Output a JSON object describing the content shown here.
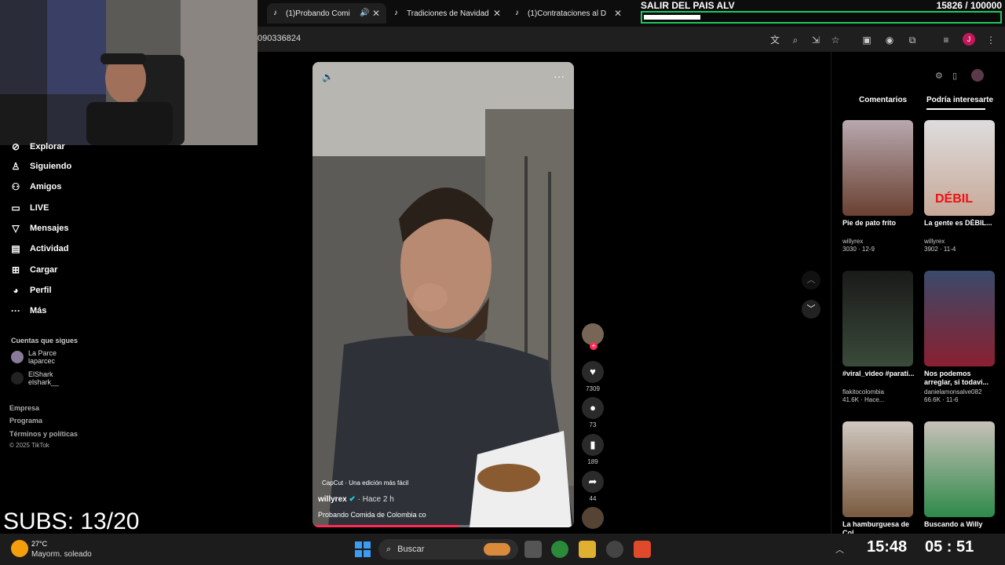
{
  "tabs": [
    {
      "title": "(1)Probando Comi"
    },
    {
      "title": "Tradiciones de Navidad"
    },
    {
      "title": "(1)Contrataciones al D"
    }
  ],
  "address": {
    "text": "090336824"
  },
  "goal": {
    "title": "SALIR DEL PAIS ALV",
    "current": "15826",
    "target": "/ 100000",
    "progress": 0.158
  },
  "sidebar": {
    "items": [
      {
        "label": "Explorar",
        "icon": "compass-icon"
      },
      {
        "label": "Siguiendo",
        "icon": "user-icon"
      },
      {
        "label": "Amigos",
        "icon": "friends-icon"
      },
      {
        "label": "LIVE",
        "icon": "live-icon"
      },
      {
        "label": "Mensajes",
        "icon": "send-icon"
      },
      {
        "label": "Actividad",
        "icon": "activity-icon"
      },
      {
        "label": "Cargar",
        "icon": "upload-icon"
      },
      {
        "label": "Perfil",
        "icon": "avatar-icon"
      },
      {
        "label": "Más",
        "icon": "more-icon"
      }
    ],
    "follow_title": "Cuentas que sigues",
    "accounts": [
      {
        "name": "La Parce",
        "handle": "laparcec"
      },
      {
        "name": "ElShark",
        "handle": "elshark__"
      }
    ],
    "footer": [
      "Empresa",
      "Programa",
      "Términos y políticas",
      "© 2025 TikTok"
    ]
  },
  "video": {
    "capcut": "CapCut · Una edición más fácil",
    "author": "willyrex",
    "time": "· Hace 2 h",
    "description": "Probando Comida de Colombia co",
    "progress": 0.56
  },
  "actions": {
    "likes": "7309",
    "comments": "73",
    "saves": "189",
    "shares": "44"
  },
  "rightpanel": {
    "tab_comments": "Comentarios",
    "tab_suggested": "Podría interesarte",
    "cards": [
      {
        "title": "Pie de pato frito",
        "user": "willyrex",
        "stats": "3030 · 12-9"
      },
      {
        "title": "La gente es DÉBIL...",
        "user": "willyrex",
        "stats": "3902 · 11-4"
      },
      {
        "title": "#viral_video #parati...",
        "user": "flakitocolombia",
        "stats": "41.6K · Hace..."
      },
      {
        "title": "Nos podemos arreglar, si todavi...",
        "user": "danielamonsalve082",
        "stats": "66.6K · 11-6"
      },
      {
        "title": "La hamburguesa de Col...",
        "user": "",
        "stats": ""
      },
      {
        "title": "Buscando a Willy",
        "user": "",
        "stats": ""
      }
    ]
  },
  "taskbar": {
    "weather_temp": "27°C",
    "weather_desc": "Mayorm. soleado",
    "search_placeholder": "Buscar",
    "clock_left": "15:48",
    "clock_right": "05 : 51"
  },
  "overlay": {
    "subs": "SUBS: 13/20"
  }
}
